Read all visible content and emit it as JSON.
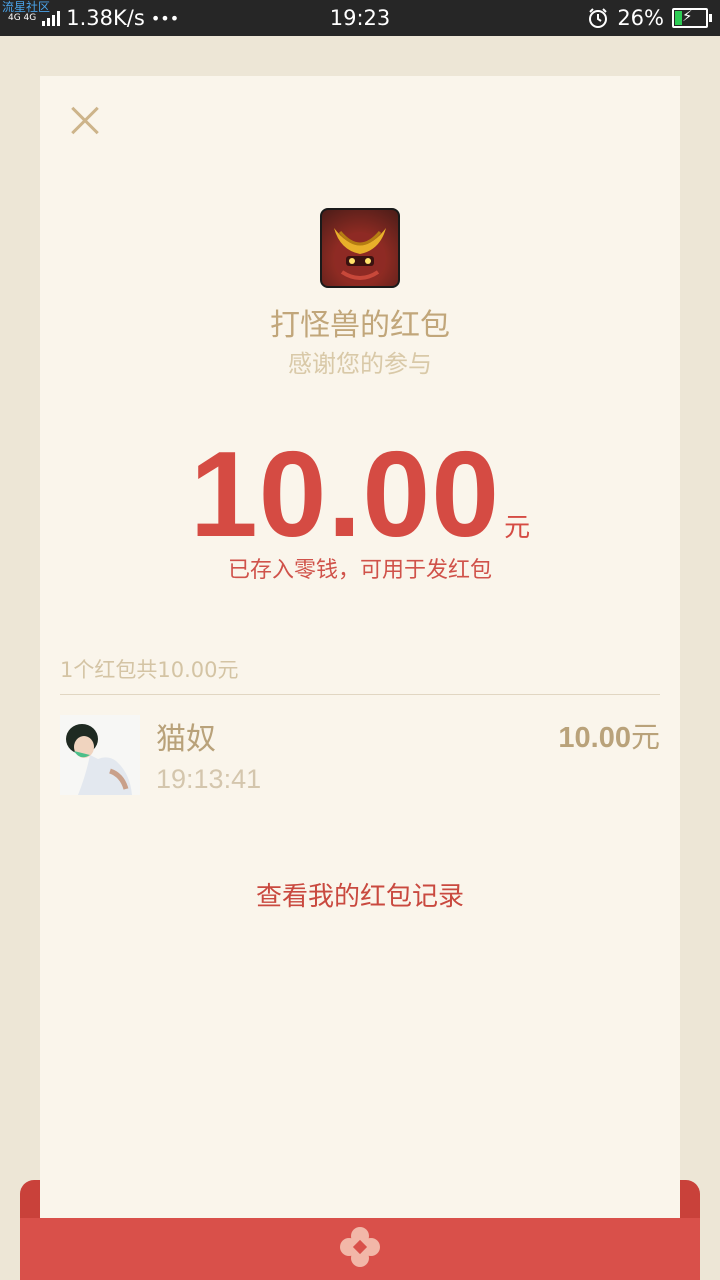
{
  "status_bar": {
    "watermark": "流星社区",
    "network_tag": "4G 4G",
    "speed": "1.38K/s",
    "more": "•••",
    "time": "19:23",
    "battery": "26%",
    "battery_level": 0.26
  },
  "sender": {
    "name": "打怪兽的红包",
    "greeting": "感谢您的参与"
  },
  "amount": {
    "value": "10.00",
    "unit": "元",
    "note": "已存入零钱，可用于发红包"
  },
  "summary": "1个红包共10.00元",
  "receivers": [
    {
      "name": "猫奴",
      "time": "19:13:41",
      "amount": "10.00",
      "unit": "元"
    }
  ],
  "records_link": "查看我的红包记录",
  "colors": {
    "accent_red": "#d54b43",
    "gold_text": "#b9a27a",
    "card_bg": "#faf5eb",
    "page_bg": "#ede6d6"
  },
  "icons": {
    "close": "close-icon",
    "sender_avatar": "samurai-avatar",
    "seal": "flower-seal-icon"
  }
}
